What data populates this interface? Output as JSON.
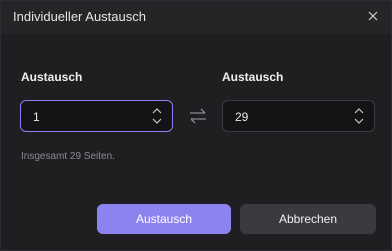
{
  "dialog": {
    "title": "Individueller Austausch",
    "left_label": "Austausch",
    "right_label": "Austausch",
    "left_value": "1",
    "right_value": "29",
    "info": "Insgesamt 29 Seiten.",
    "confirm_label": "Austausch",
    "cancel_label": "Abbrechen"
  },
  "colors": {
    "background": "#1f1f22",
    "accent": "#8d83f0",
    "focus_border": "#8b7ff2",
    "secondary_button": "#3a3a3f"
  }
}
